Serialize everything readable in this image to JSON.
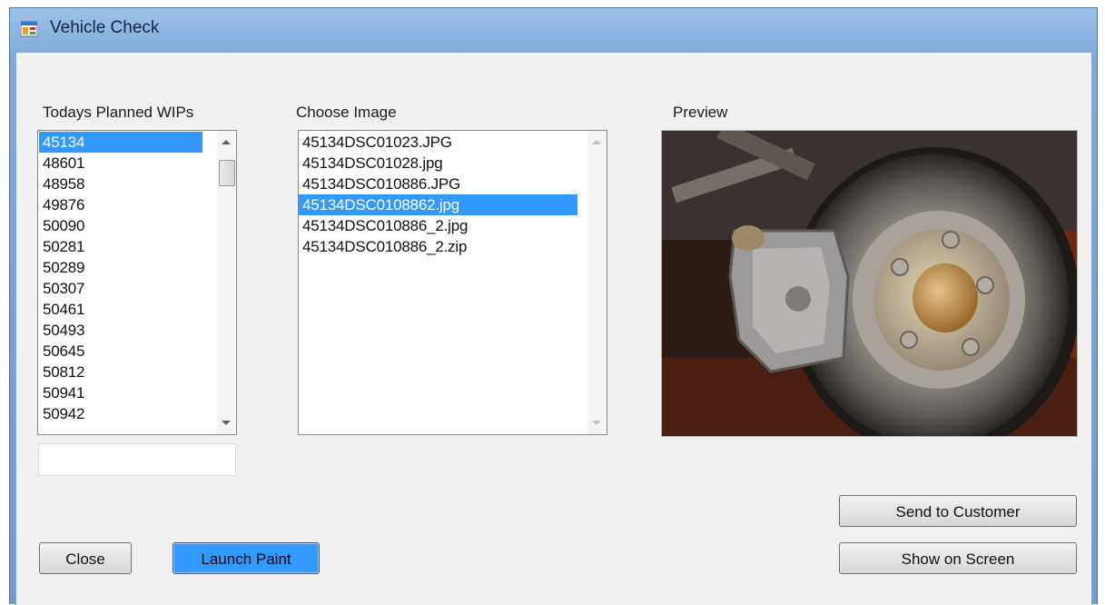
{
  "window": {
    "title": "Vehicle Check"
  },
  "wips": {
    "label": "Todays Planned WIPs",
    "items": [
      "45134",
      "48601",
      "48958",
      "49876",
      "50090",
      "50281",
      "50289",
      "50307",
      "50461",
      "50493",
      "50645",
      "50812",
      "50941",
      "50942"
    ],
    "selected_index": 0,
    "search_value": ""
  },
  "images": {
    "label": "Choose Image",
    "items": [
      "45134DSC01023.JPG",
      "45134DSC01028.jpg",
      "45134DSC010886.JPG",
      "45134DSC0108862.jpg",
      "45134DSC010886_2.jpg",
      "45134DSC010886_2.zip"
    ],
    "selected_index": 3
  },
  "preview": {
    "label": "Preview"
  },
  "buttons": {
    "close": "Close",
    "launch_paint": "Launch Paint",
    "send_to_customer": "Send to Customer",
    "show_on_screen": "Show on Screen"
  },
  "colors": {
    "selection": "#3399ff",
    "window_frame": "#7fa9d8",
    "client_bg": "#f0f0f0"
  }
}
